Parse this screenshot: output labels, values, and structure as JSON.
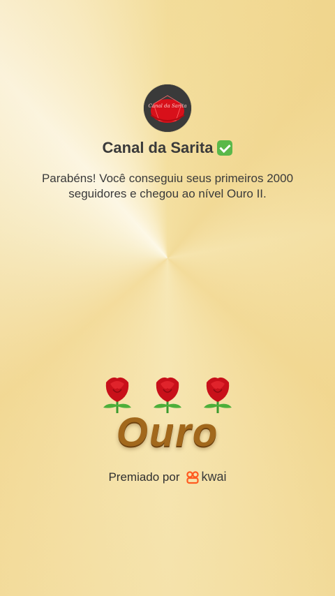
{
  "profile": {
    "avatar_text": "Canal da Sarita",
    "name": "Canal da Sarita",
    "verified_icon": "check-box-icon"
  },
  "message": "Parabéns! Você conseguiu seus primeiros 2000 seguidores e chegou ao nível Ouro II.",
  "badge": {
    "rose_icon": "rose-icon",
    "rose_count": 3,
    "level": "Ouro"
  },
  "award": {
    "label": "Premiado por",
    "brand": "kwai"
  },
  "colors": {
    "level_text": "#a2681c",
    "kwai_logo": "#ff5a1f",
    "verified": "#5ab84a"
  }
}
